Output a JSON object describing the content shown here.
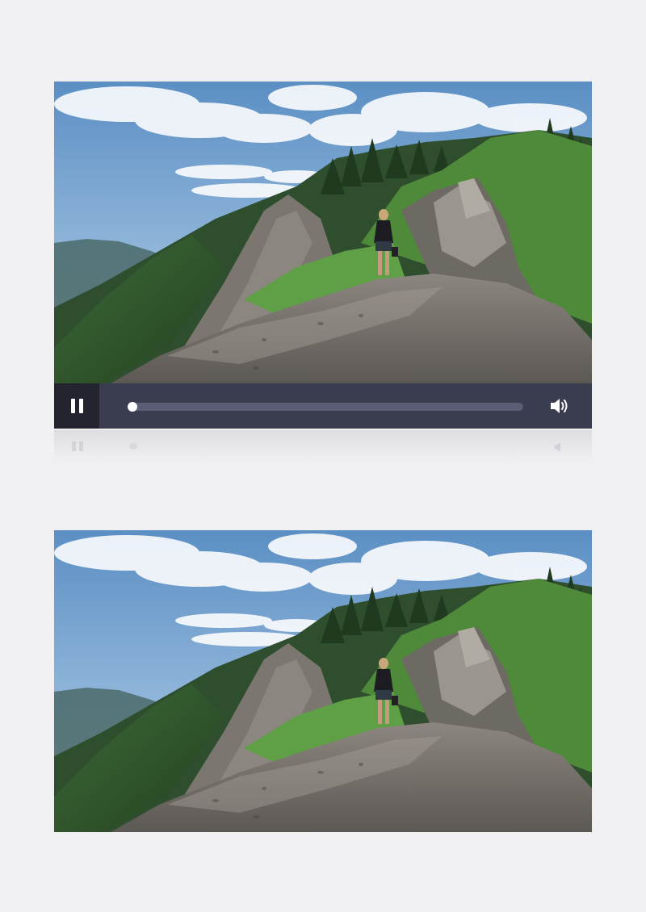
{
  "player": {
    "video": {
      "scene": "woman-hiking-granite-ridge",
      "progress": 0
    },
    "controls": {
      "play_state": "playing",
      "pause_icon": "pause-icon",
      "volume_icon": "volume-icon"
    }
  },
  "preview": {
    "scene": "woman-hiking-granite-ridge"
  },
  "colors": {
    "page_background": "#f0f0f2",
    "control_bar": "#3a3c50",
    "pause_button_bg": "#23242f",
    "track": "#5a5d74"
  }
}
